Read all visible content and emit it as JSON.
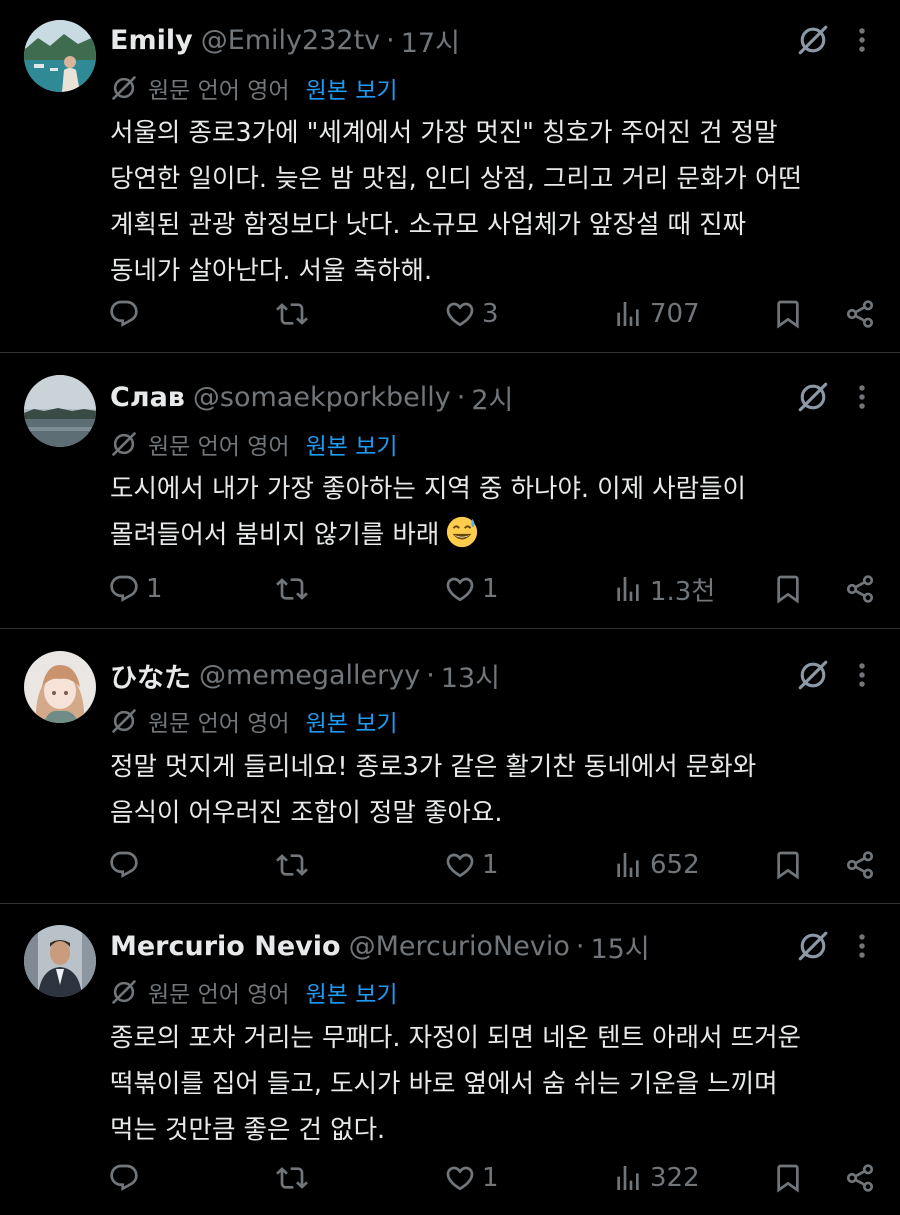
{
  "translate": {
    "label": "원문 언어 영어",
    "link": "원본 보기"
  },
  "tweets": [
    {
      "name": "Emily",
      "handle": "@Emily232tv",
      "time": "17시",
      "lines": [
        "서울의 종로3가에 \"세계에서 가장 멋진\" 칭호가 주어진 건 정말",
        "당연한 일이다. 늦은 밤 맛집, 인디 상점, 그리고 거리 문화가 어떤",
        "계획된 관광 함정보다 낫다. 소규모 사업체가 앞장설 때 진짜",
        "동네가 살아난다. 서울 축하해."
      ],
      "replies": "",
      "retweets": "",
      "likes": "3",
      "views": "707"
    },
    {
      "name": "Слав",
      "handle": "@somaekporkbelly",
      "time": "2시",
      "lines": [
        "도시에서 내가 가장 좋아하는 지역 중 하나야. 이제 사람들이",
        "몰려들어서 붐비지 않기를 바래"
      ],
      "replies": "1",
      "retweets": "",
      "likes": "1",
      "views": "1.3천"
    },
    {
      "name": "ひなた",
      "handle": "@memegalleryy",
      "time": "13시",
      "lines": [
        "정말 멋지게 들리네요! 종로3가 같은 활기찬 동네에서 문화와",
        "음식이 어우러진 조합이 정말 좋아요."
      ],
      "replies": "",
      "retweets": "",
      "likes": "1",
      "views": "652"
    },
    {
      "name": "Mercurio Nevio",
      "handle": "@MercurioNevio",
      "time": "15시",
      "lines": [
        "종로의 포차 거리는 무패다. 자정이 되면 네온 텐트 아래서 뜨거운",
        "떡볶이를 집어 들고, 도시가 바로 옆에서 숨 쉬는 기운을 느끼며",
        "먹는 것만큼 좋은 건 없다."
      ],
      "replies": "",
      "retweets": "",
      "likes": "1",
      "views": "322"
    }
  ]
}
